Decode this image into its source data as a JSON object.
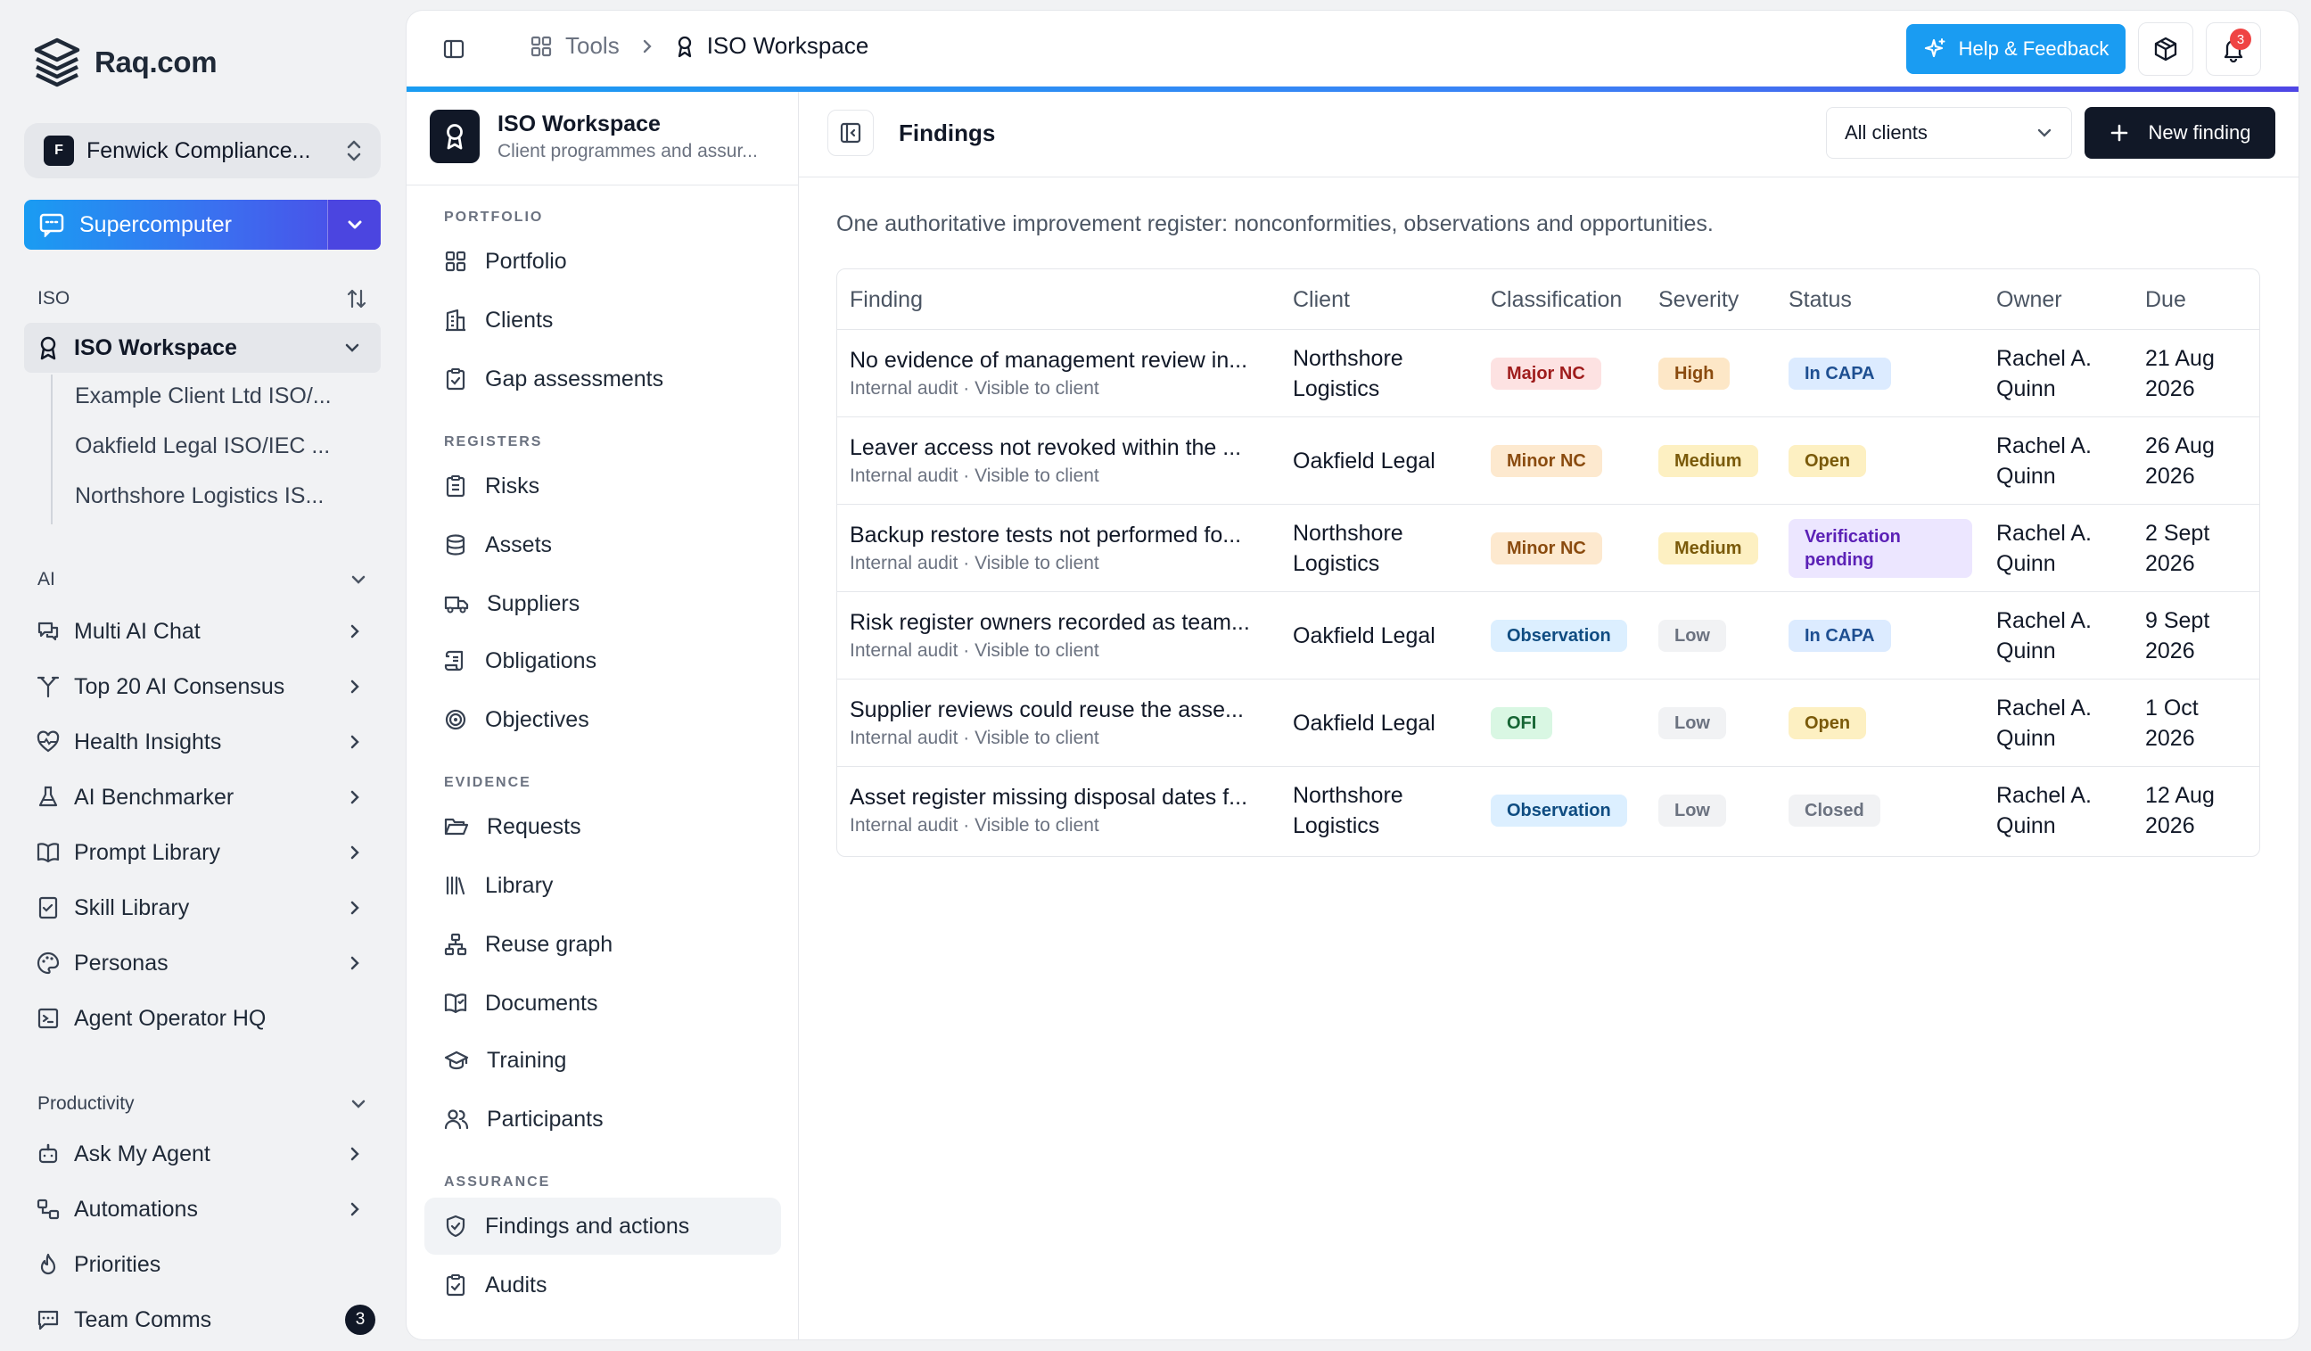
{
  "brand": {
    "name": "Raq.com"
  },
  "org_switcher": {
    "badge": "F",
    "name": "Fenwick Compliance..."
  },
  "supercomputer": {
    "label": "Supercomputer"
  },
  "sidebar": {
    "iso_section": {
      "title": "ISO",
      "workspace": "ISO Workspace",
      "sub_items": [
        "Example Client Ltd ISO/...",
        "Oakfield Legal ISO/IEC ...",
        "Northshore Logistics IS..."
      ]
    },
    "ai_section": {
      "title": "AI",
      "items": [
        "Multi AI Chat",
        "Top 20 AI Consensus",
        "Health Insights",
        "AI Benchmarker",
        "Prompt Library",
        "Skill Library",
        "Personas",
        "Agent Operator HQ"
      ]
    },
    "productivity_section": {
      "title": "Productivity",
      "items": [
        "Ask My Agent",
        "Automations",
        "Priorities",
        "Team Comms"
      ],
      "team_comms_count": "3"
    }
  },
  "topbar": {
    "crumb_tools": "Tools",
    "crumb_current": "ISO Workspace",
    "help_label": "Help & Feedback",
    "notifications_count": "3"
  },
  "inner_nav": {
    "workspace_title": "ISO Workspace",
    "workspace_subtitle": "Client programmes and assur...",
    "groups": {
      "portfolio": "PORTFOLIO",
      "registers": "REGISTERS",
      "evidence": "EVIDENCE",
      "assurance": "ASSURANCE"
    },
    "portfolio_items": [
      "Portfolio",
      "Clients",
      "Gap assessments"
    ],
    "registers_items": [
      "Risks",
      "Assets",
      "Suppliers",
      "Obligations",
      "Objectives"
    ],
    "evidence_items": [
      "Requests",
      "Library",
      "Reuse graph",
      "Documents",
      "Training",
      "Participants"
    ],
    "assurance_items": [
      "Findings and actions",
      "Audits"
    ]
  },
  "content": {
    "title": "Findings",
    "client_filter": "All clients",
    "new_button": "New finding",
    "intro": "One authoritative improvement register: nonconformities, observations and opportunities.",
    "columns": [
      "Finding",
      "Client",
      "Classification",
      "Severity",
      "Status",
      "Owner",
      "Due"
    ],
    "rows": [
      {
        "title": "No evidence of management review in...",
        "meta": "Internal audit · Visible to client",
        "client": "Northshore Logistics",
        "classification": "Major NC",
        "severity": "High",
        "status": "In CAPA",
        "owner": "Rachel A. Quinn",
        "due": "21 Aug 2026"
      },
      {
        "title": "Leaver access not revoked within the ...",
        "meta": "Internal audit · Visible to client",
        "client": "Oakfield Legal",
        "classification": "Minor NC",
        "severity": "Medium",
        "status": "Open",
        "owner": "Rachel A. Quinn",
        "due": "26 Aug 2026"
      },
      {
        "title": "Backup restore tests not performed fo...",
        "meta": "Internal audit · Visible to client",
        "client": "Northshore Logistics",
        "classification": "Minor NC",
        "severity": "Medium",
        "status": "Verification pending",
        "owner": "Rachel A. Quinn",
        "due": "2 Sept 2026"
      },
      {
        "title": "Risk register owners recorded as team...",
        "meta": "Internal audit · Visible to client",
        "client": "Oakfield Legal",
        "classification": "Observation",
        "severity": "Low",
        "status": "In CAPA",
        "owner": "Rachel A. Quinn",
        "due": "9 Sept 2026"
      },
      {
        "title": "Supplier reviews could reuse the asse...",
        "meta": "Internal audit · Visible to client",
        "client": "Oakfield Legal",
        "classification": "OFI",
        "severity": "Low",
        "status": "Open",
        "owner": "Rachel A. Quinn",
        "due": "1 Oct 2026"
      },
      {
        "title": "Asset register missing disposal dates f...",
        "meta": "Internal audit · Visible to client",
        "client": "Northshore Logistics",
        "classification": "Observation",
        "severity": "Low",
        "status": "Closed",
        "owner": "Rachel A. Quinn",
        "due": "12 Aug 2026"
      }
    ]
  },
  "colors": {
    "accent_blue": "#1a9cf2",
    "indigo": "#4f46e5",
    "major_nc_bg": "#fde2e2",
    "major_nc_fg": "#9f1c1c",
    "minor_nc_bg": "#fde9cf",
    "minor_nc_fg": "#8a4b0f",
    "observation_bg": "#dcefff",
    "observation_fg": "#0f4c81",
    "ofi_bg": "#d9f7e3",
    "ofi_fg": "#166534",
    "high_bg": "#fde7c7",
    "high_fg": "#8a4b0f",
    "medium_bg": "#fdf0c2",
    "medium_fg": "#7a5a0a",
    "low_bg": "#f1f2f4",
    "low_fg": "#6b7280",
    "in_capa_bg": "#dcebff",
    "in_capa_fg": "#1e4f91",
    "open_bg": "#fdf0c2",
    "open_fg": "#7a5a0a",
    "verification_bg": "#ece6ff",
    "verification_fg": "#5b21b6",
    "closed_bg": "#f1f2f4",
    "closed_fg": "#6b7280"
  }
}
